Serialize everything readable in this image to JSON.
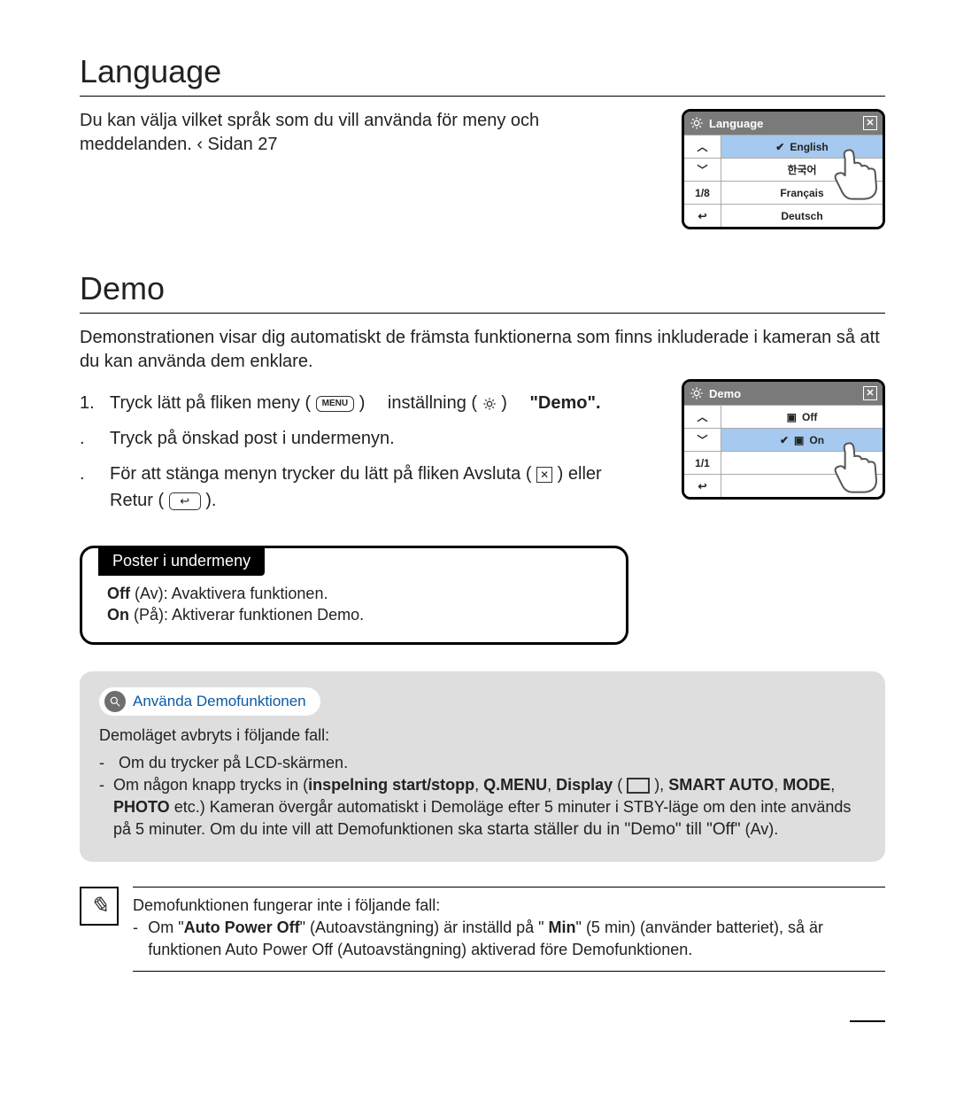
{
  "language": {
    "title": "Language",
    "body_1": "Du kan välja vilket språk som du vill använda för meny och meddelanden.",
    "page_ref": "‹ Sidan 27",
    "screenshot": {
      "header": "Language",
      "page_indicator": "1/8",
      "options": [
        "English",
        "한국어",
        "Français",
        "Deutsch"
      ],
      "selected_index": 0
    }
  },
  "demo": {
    "title": "Demo",
    "intro": "Demonstrationen visar dig automatiskt de främsta funktionerna som finns inkluderade i kameran så att du kan använda dem enklare.",
    "step1_a": "Tryck lätt på fliken meny (",
    "step1_menu": "MENU",
    "step1_b": ")",
    "step1_setting": "inställning (",
    "step1_c": ")",
    "step1_demo_label": "\"Demo\".",
    "step2": "Tryck på önskad post i undermenyn.",
    "step3_a": "För att stänga menyn trycker du lätt på fliken Avsluta (",
    "step3_b": ") eller Retur (",
    "step3_c": ").",
    "screenshot": {
      "header": "Demo",
      "page_indicator": "1/1",
      "options": [
        "Off",
        "On"
      ],
      "selected_index": 1
    },
    "submenu": {
      "tab": "Poster i undermeny",
      "off_label": "Off",
      "off_desc": " (Av): Avaktivera funktionen.",
      "on_label": "On",
      "on_desc": " (På): Aktiverar funktionen Demo."
    },
    "tip": {
      "pill": "Använda Demofunktionen",
      "line1": "Demoläget avbryts i följande fall:",
      "bullet1": "Om du trycker på LCD-skärmen.",
      "bullet2_a": "Om någon knapp trycks in (",
      "b_rec": "inspelning start/stopp",
      "b_qmenu": "Q.MENU",
      "b_display": "Display",
      "b_smartauto": "SMART AUTO",
      "b_mode": "MODE",
      "b_photo": "PHOTO",
      "bullet2_b": " etc.) Kameran övergår automatiskt i Demoläge efter 5 minuter i STBY-läge om den inte används på 5 minuter. Om du inte vill att Demofunktionen ska ",
      "bullet2_c": "starta ställer du in \"Demo\" till \"Off\"",
      "bullet2_d": " (Av)."
    },
    "note": {
      "line1": "Demofunktionen fungerar inte i följande fall:",
      "bullet_a": "Om \"",
      "apoff": "Auto Power Off",
      "bullet_b": "\" (Autoavstängning) är inställd på \" ",
      "min": "Min",
      "bullet_c": "\" (5 min) (använder batteriet), så är funktionen Auto Power Off (Autoavstängning) aktiverad före Demofunktionen."
    }
  }
}
